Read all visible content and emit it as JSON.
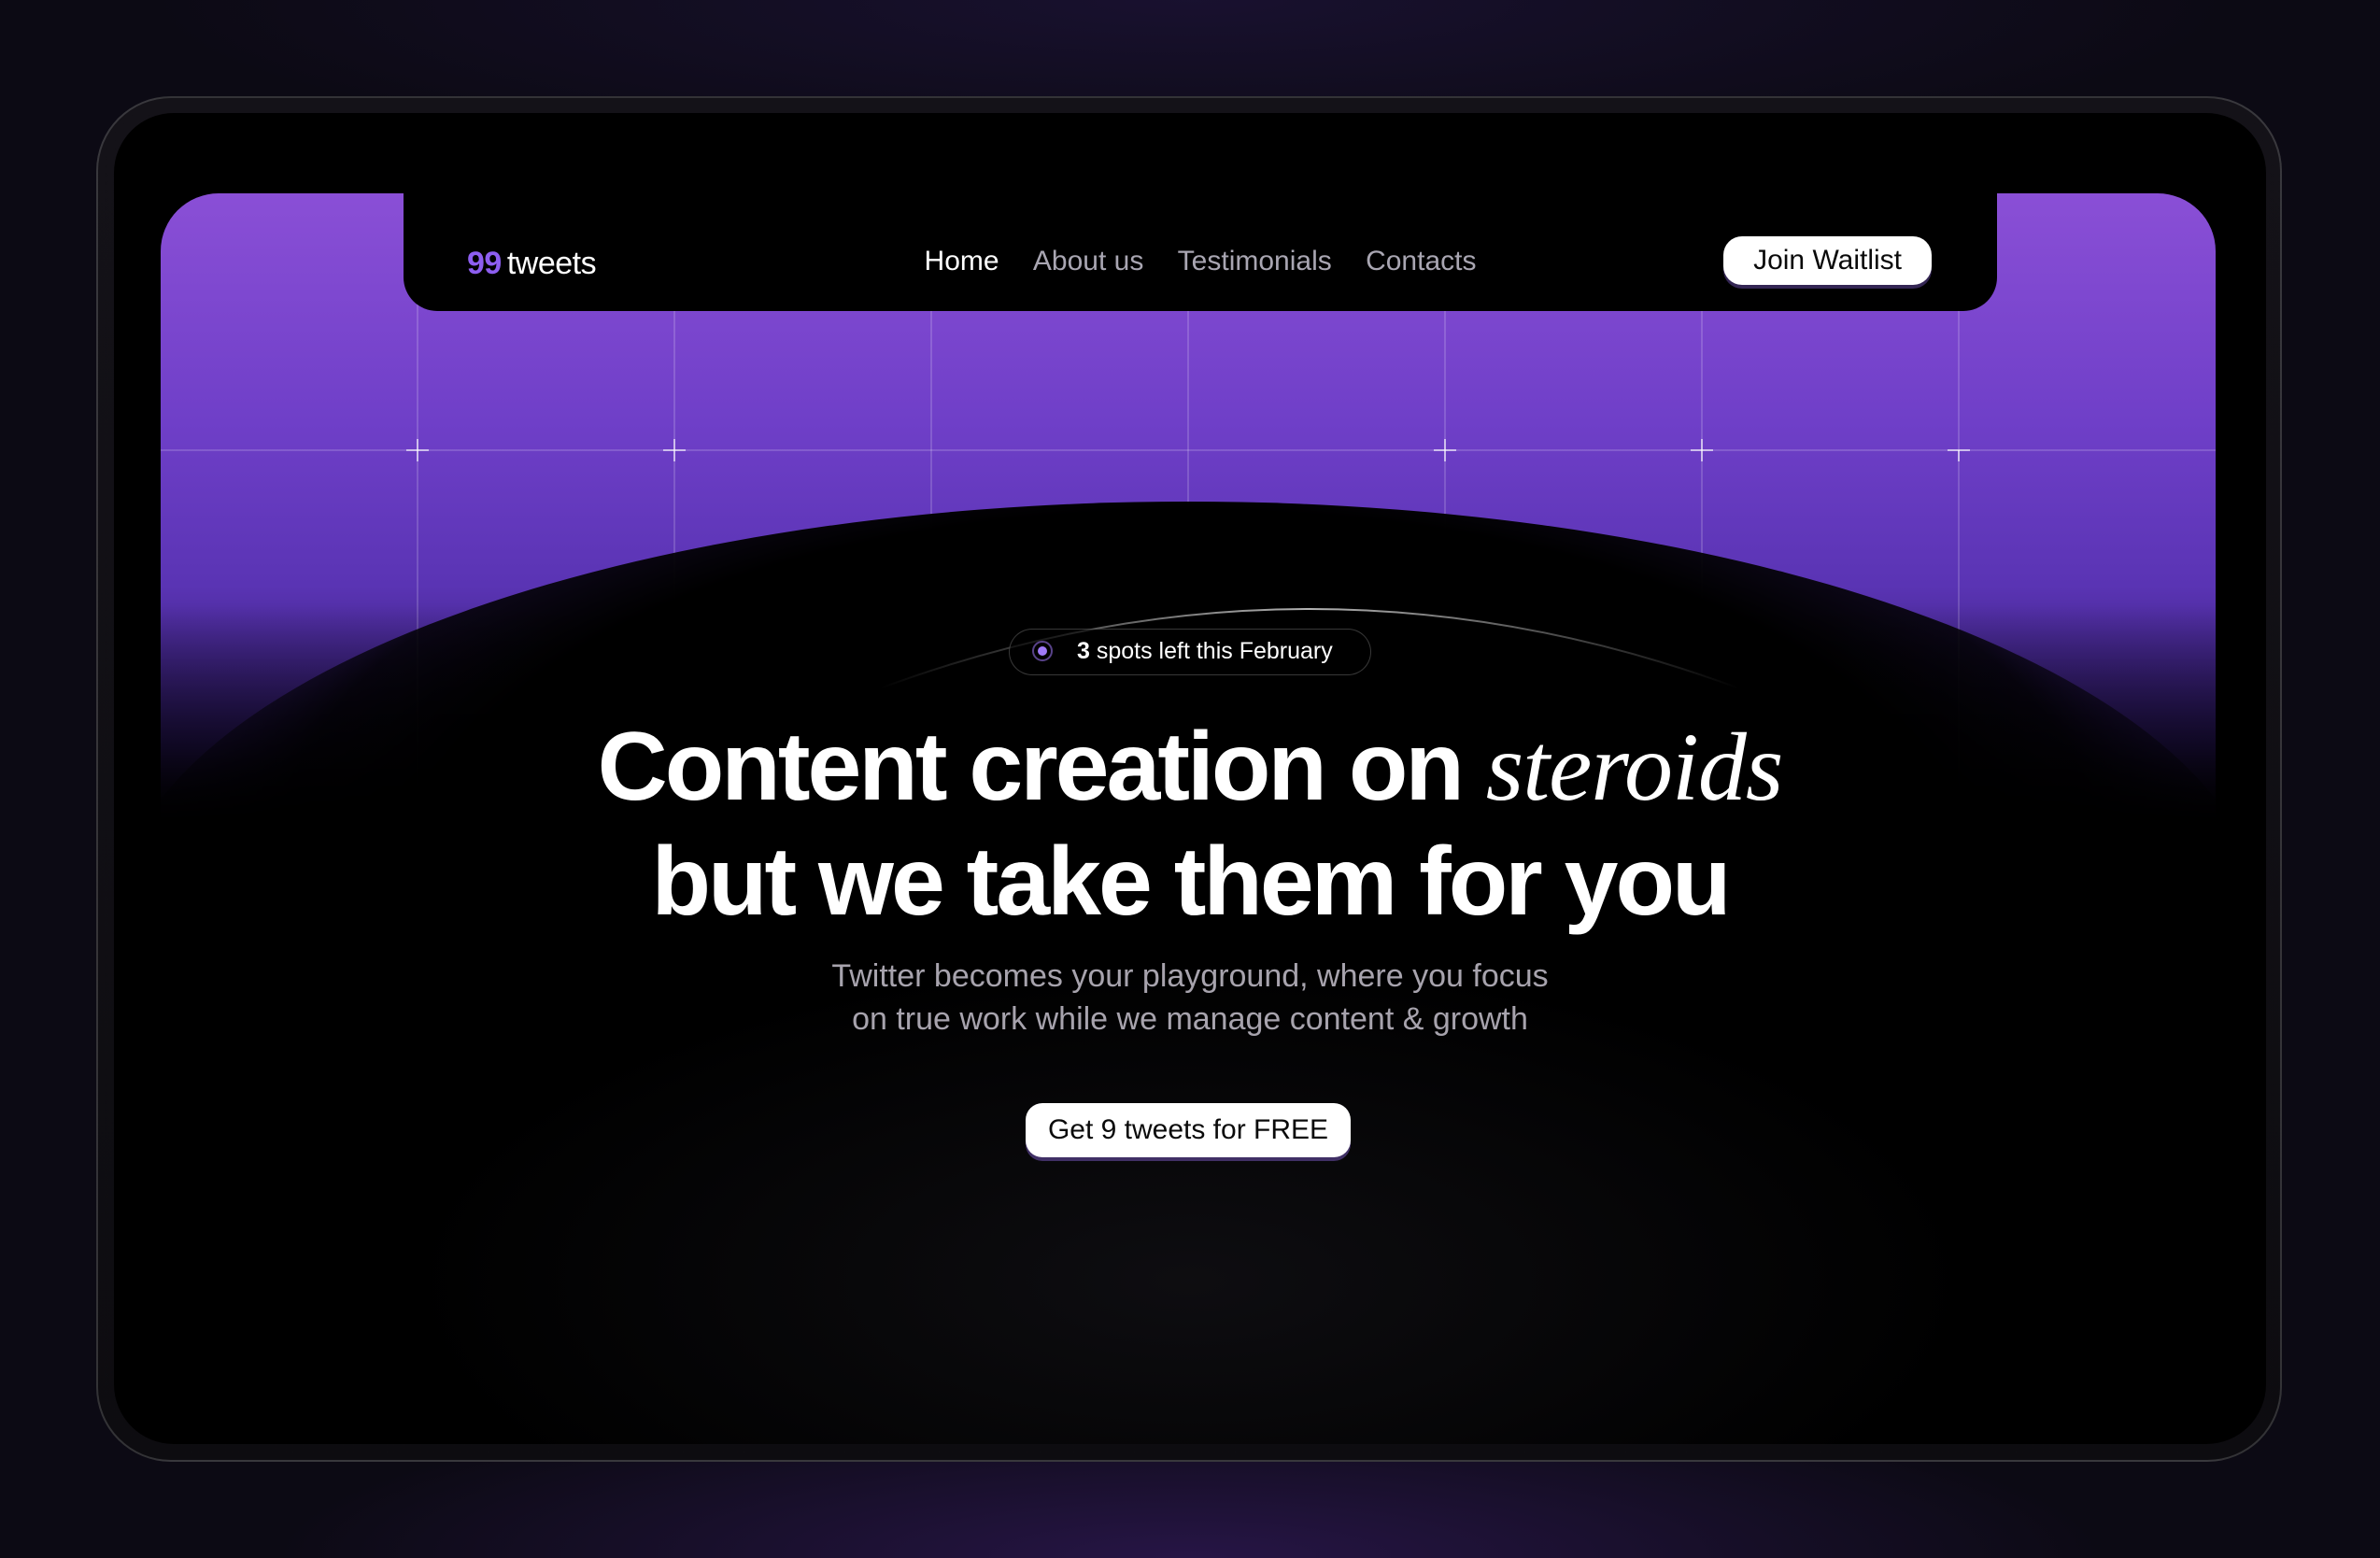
{
  "brand": {
    "number": "99",
    "name": "tweets"
  },
  "nav": {
    "items": [
      {
        "label": "Home",
        "active": true
      },
      {
        "label": "About us",
        "active": false
      },
      {
        "label": "Testimonials",
        "active": false
      },
      {
        "label": "Contacts",
        "active": false
      }
    ],
    "cta_label": "Join Waitlist"
  },
  "hero": {
    "badge": {
      "count": "3",
      "text": "spots left this February"
    },
    "headline_line1": "Content creation on",
    "headline_emphasis": "steroids",
    "headline_line2": "but we take them for you",
    "subtitle_line1": "Twitter becomes your playground, where you focus",
    "subtitle_line2": "on true work while we manage content & growth",
    "cta_label": "Get 9 tweets for FREE"
  },
  "colors": {
    "accent": "#8d5ef0",
    "hero_purple": "#7a45d0",
    "background": "#000000",
    "button_bg": "#ffffff"
  }
}
